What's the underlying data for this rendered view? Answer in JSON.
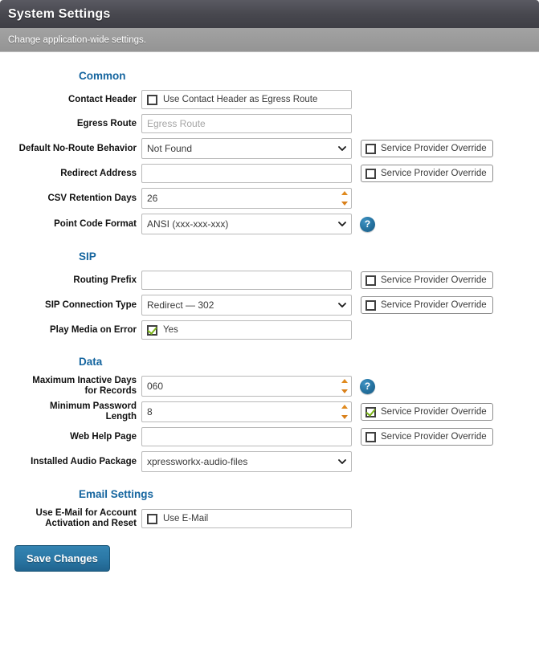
{
  "header": {
    "title": "System Settings",
    "subtitle": "Change application-wide settings."
  },
  "sections": {
    "common": {
      "title": "Common",
      "contact_header": {
        "label": "Contact Header",
        "checkbox_label": "Use Contact Header as Egress Route",
        "checked": false
      },
      "egress_route": {
        "label": "Egress Route",
        "value": "",
        "placeholder": "Egress Route"
      },
      "default_no_route_behavior": {
        "label": "Default No-Route Behavior",
        "value": "Not Found",
        "override_label": "Service Provider Override",
        "override_checked": false
      },
      "redirect_address": {
        "label": "Redirect Address",
        "value": "",
        "override_label": "Service Provider Override",
        "override_checked": false
      },
      "csv_retention_days": {
        "label": "CSV Retention Days",
        "value": "26"
      },
      "point_code_format": {
        "label": "Point Code Format",
        "value": "ANSI (xxx-xxx-xxx)",
        "help": "?"
      }
    },
    "sip": {
      "title": "SIP",
      "routing_prefix": {
        "label": "Routing Prefix",
        "value": "",
        "override_label": "Service Provider Override",
        "override_checked": false
      },
      "sip_connection_type": {
        "label": "SIP Connection Type",
        "value": "Redirect — 302",
        "override_label": "Service Provider Override",
        "override_checked": false
      },
      "play_media_on_error": {
        "label": "Play Media on Error",
        "checkbox_label": "Yes",
        "checked": true
      }
    },
    "data": {
      "title": "Data",
      "maximum_inactive_days": {
        "label_line1": "Maximum Inactive Days",
        "label_line2": "for Records",
        "value": "060",
        "help": "?"
      },
      "minimum_password_length": {
        "label_line1": "Minimum Password",
        "label_line2": "Length",
        "value": "8",
        "override_label": "Service Provider Override",
        "override_checked": true
      },
      "web_help_page": {
        "label": "Web Help Page",
        "value": "",
        "override_label": "Service Provider Override",
        "override_checked": false
      },
      "installed_audio_package": {
        "label": "Installed Audio Package",
        "value": "xpressworkx-audio-files"
      }
    },
    "email": {
      "title": "Email Settings",
      "use_email": {
        "label_line1": "Use E-Mail for Account",
        "label_line2": "Activation and Reset",
        "checkbox_label": "Use E-Mail",
        "checked": false
      }
    }
  },
  "footer": {
    "save_label": "Save Changes"
  },
  "colors": {
    "heading_blue": "#15659f",
    "check_green": "#7ab317",
    "button_blue": "#2b78a6",
    "help_blue": "#24719e"
  }
}
